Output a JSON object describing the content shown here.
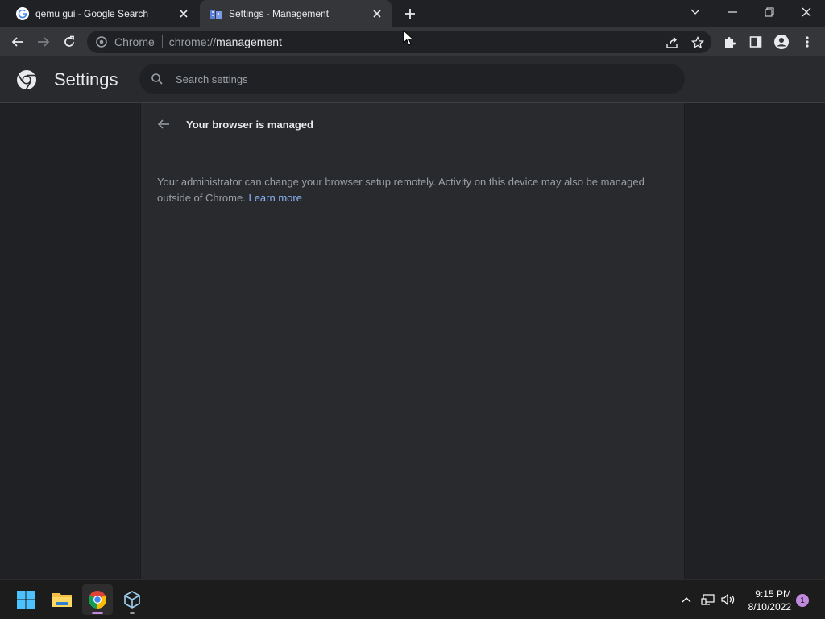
{
  "tabs": [
    {
      "title": "qemu gui - Google Search",
      "favicon": "google-g-icon",
      "active": false
    },
    {
      "title": "Settings - Management",
      "favicon": "settings-page-icon",
      "active": true
    }
  ],
  "omnibox": {
    "site_chip": "Chrome",
    "url_prefix": "chrome://",
    "url_host": "management"
  },
  "settings": {
    "title": "Settings",
    "search_placeholder": "Search settings"
  },
  "management": {
    "heading": "Your browser is managed",
    "description": "Your administrator can change your browser setup remotely. Activity on this device may also be managed outside of Chrome.",
    "learn_more": "Learn more"
  },
  "taskbar": {
    "apps": [
      "windows-start-icon",
      "file-explorer-icon",
      "chrome-icon",
      "virtualbox-icon"
    ],
    "time": "9:15 PM",
    "date": "8/10/2022",
    "notification_count": "1"
  },
  "colors": {
    "accent": "#8ab4f8",
    "background": "#202124",
    "surface": "#292a2d",
    "text": "#e8eaed"
  }
}
